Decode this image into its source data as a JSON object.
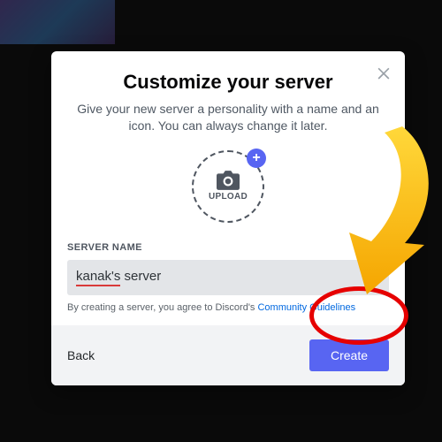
{
  "modal": {
    "title": "Customize your server",
    "subtitle": "Give your new server a personality with a name and an icon. You can always change it later.",
    "upload_label": "UPLOAD",
    "field_label": "SERVER NAME",
    "server_name_typed": "kanak's",
    "server_name_rest": " server",
    "helper_pre": "By creating a server, you agree to Discord's ",
    "helper_link": "Community Guidelines",
    "back_label": "Back",
    "create_label": "Create"
  }
}
